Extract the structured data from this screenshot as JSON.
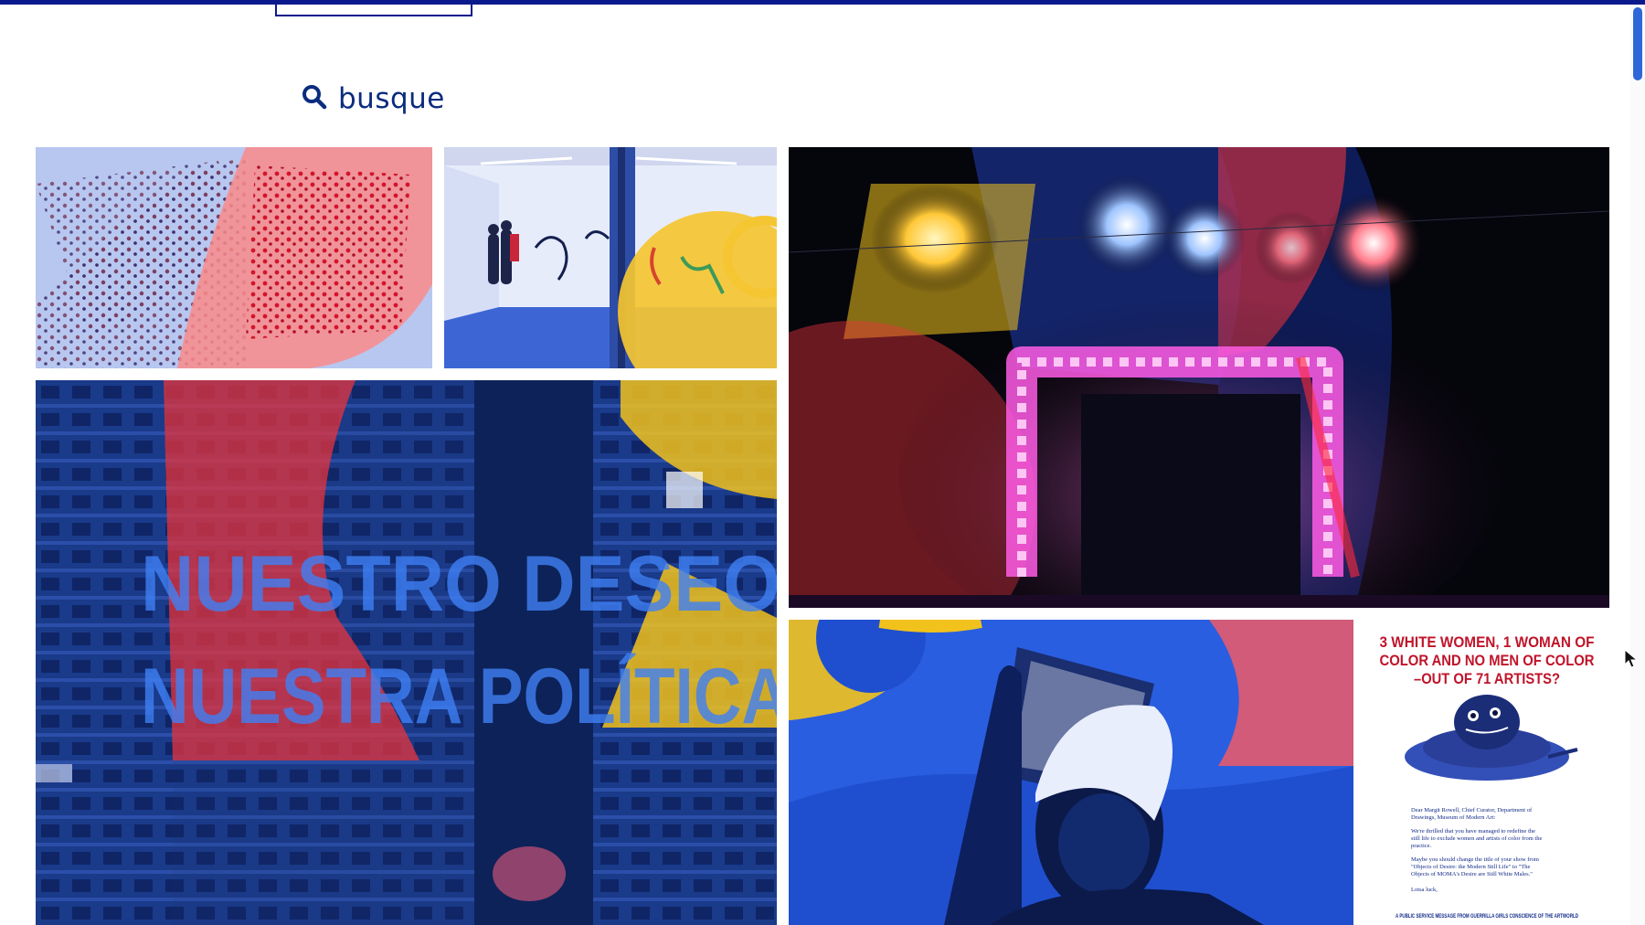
{
  "search": {
    "label": "busque",
    "icon": "search-icon"
  },
  "artworks": {
    "projection_line1": "NUESTRO DESEO",
    "projection_line2": "NUESTRA POLÍTICA",
    "poster": {
      "headline_line1": "3 WHITE WOMEN, 1 WOMAN OF",
      "headline_line2": "COLOR AND NO MEN OF COLOR",
      "headline_line3": "–OUT OF 71 ARTISTS?",
      "letter_line1": "Dear Margit Rowell, Chief Curator, Department of",
      "letter_line2": "Drawings, Museum of Modern Art:",
      "letter_line3": "We're thrilled that you have managed to redefine the",
      "letter_line4": "still life to exclude women and artists of color from the",
      "letter_line5": "practice.",
      "letter_line6": "Maybe you should change the title of your show from",
      "letter_line7": "\"Objects of Desire: the Modern Still Life\" to \"The",
      "letter_line8": "Objects of MOMA's Desire are Still White Males.\"",
      "signoff": "Lotsa luck,",
      "footer": "A PUBLIC SERVICE MESSAGE FROM GUERRILLA GIRLS CONSCIENCE OF THE ARTWORLD"
    }
  },
  "colors": {
    "brand_blue": "#0a1a8c",
    "search_text": "#0b2c7e",
    "overlay_red": "#e8343c",
    "overlay_yellow": "#f2c21c",
    "overlay_blue": "#1f57d6"
  }
}
